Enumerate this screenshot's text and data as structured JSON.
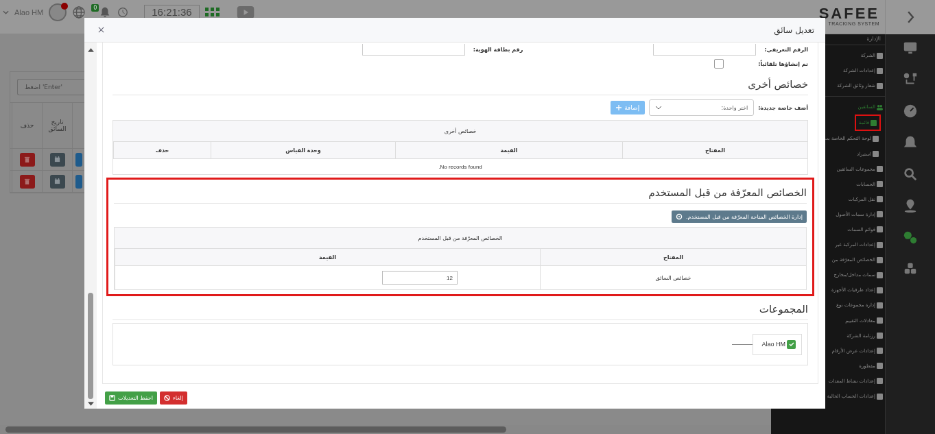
{
  "topbar": {
    "user": "Alao HM",
    "notifications": "0",
    "clock": "16:21:36",
    "logo": "SAFEE",
    "logo_tagline": "TRACKING SYSTEM"
  },
  "background_table": {
    "search_placeholder": "اضغط 'Enter'",
    "columns": [
      "تاريخ السائق",
      "حذف"
    ]
  },
  "sidebar": {
    "header": "الإدارة",
    "items": [
      {
        "label": "الشركة",
        "kind": "item",
        "selected": false,
        "highlighted": false
      },
      {
        "label": "إعدادات الشركة",
        "kind": "item",
        "selected": false,
        "highlighted": false
      },
      {
        "label": "شعار وثائق الشركة",
        "kind": "item",
        "selected": false,
        "highlighted": false
      },
      {
        "label": "السائقين",
        "kind": "group",
        "selected": true,
        "highlighted": false
      },
      {
        "label": "قائمة",
        "kind": "subitem",
        "selected": true,
        "highlighted": true
      },
      {
        "label": "لوحة التحكم الخاصة بت",
        "kind": "subitem",
        "selected": false,
        "highlighted": false
      },
      {
        "label": "استيراد",
        "kind": "subitem",
        "selected": false,
        "highlighted": false
      },
      {
        "label": "مجموعات السائقين",
        "kind": "item",
        "selected": false,
        "highlighted": false
      },
      {
        "label": "الحسابات",
        "kind": "item",
        "selected": false,
        "highlighted": false
      },
      {
        "label": "نقل المركبات",
        "kind": "item",
        "selected": false,
        "highlighted": false
      },
      {
        "label": "إدارة سمات الأصول",
        "kind": "item",
        "selected": false,
        "highlighted": false
      },
      {
        "label": "قوائم السمات",
        "kind": "item",
        "selected": false,
        "highlighted": false
      },
      {
        "label": "إعدادات المركبة غير",
        "kind": "item",
        "selected": false,
        "highlighted": false
      },
      {
        "label": "الخصائص المعرّفة من",
        "kind": "item",
        "selected": false,
        "highlighted": false
      },
      {
        "label": "سمات مداخل/مخارج",
        "kind": "item",
        "selected": false,
        "highlighted": false
      },
      {
        "label": "إعداد طرفيات الأجهزة",
        "kind": "item",
        "selected": false,
        "highlighted": false
      },
      {
        "label": "إدارة مجموعات نوع",
        "kind": "item",
        "selected": false,
        "highlighted": false
      },
      {
        "label": "معادلات التقييم",
        "kind": "item",
        "selected": false,
        "highlighted": false
      },
      {
        "label": "رزنامة الشركة",
        "kind": "item",
        "selected": false,
        "highlighted": false
      },
      {
        "label": "إعدادات عرض الأرقام",
        "kind": "item",
        "selected": false,
        "highlighted": false
      },
      {
        "label": "مقطورة",
        "kind": "item",
        "selected": false,
        "highlighted": false
      },
      {
        "label": "إعدادات نشاط المعدات",
        "kind": "item",
        "selected": false,
        "highlighted": false
      },
      {
        "label": "إعدادات الحساب الحالية",
        "kind": "item",
        "selected": false,
        "highlighted": false
      }
    ]
  },
  "rail": [
    {
      "selected": false
    },
    {
      "selected": false
    },
    {
      "selected": false
    },
    {
      "selected": false
    },
    {
      "selected": false
    },
    {
      "selected": false
    },
    {
      "selected": true
    },
    {
      "selected": false
    }
  ],
  "dialog": {
    "title": "تعديل سائق",
    "fields": [
      {
        "label": "الرقم التعريفي:"
      },
      {
        "label": "رقم بطاقة الهوية:"
      }
    ],
    "auto_created": {
      "label": "تم إنشاؤها تلقائياً:",
      "checked": false
    },
    "other": {
      "heading": "خصائص أخرى",
      "add_label": "أضف خاصة جديدة:",
      "select_placeholder": "اختر واحدة:",
      "add_button": "إضافة",
      "table_title": "خصائص أخرى",
      "columns": [
        "المفتاح",
        "القيمة",
        "وحدة القياس",
        "حذف"
      ],
      "empty": "No records found."
    },
    "user_defined": {
      "heading": "الخصائص المعرّفة من قبل المستخدم",
      "highlighted": true,
      "manage_button": "إدارة الخصائص المتاحة المعرّفة من قبل المستخدم.",
      "table_title": "الخصائص المعرّفة من قبل المستخدم",
      "columns": [
        "المفتاح",
        "القيمة"
      ],
      "rows": [
        {
          "key": "خصائص السائق",
          "value": "12"
        }
      ]
    },
    "groups": {
      "heading": "المجموعات",
      "nodes": [
        {
          "label": "Alao HM",
          "checked": true
        }
      ]
    },
    "buttons": [
      {
        "label": "إلغاء",
        "kind": "cancel"
      },
      {
        "label": "احفظ التعديلات",
        "kind": "save"
      }
    ]
  }
}
